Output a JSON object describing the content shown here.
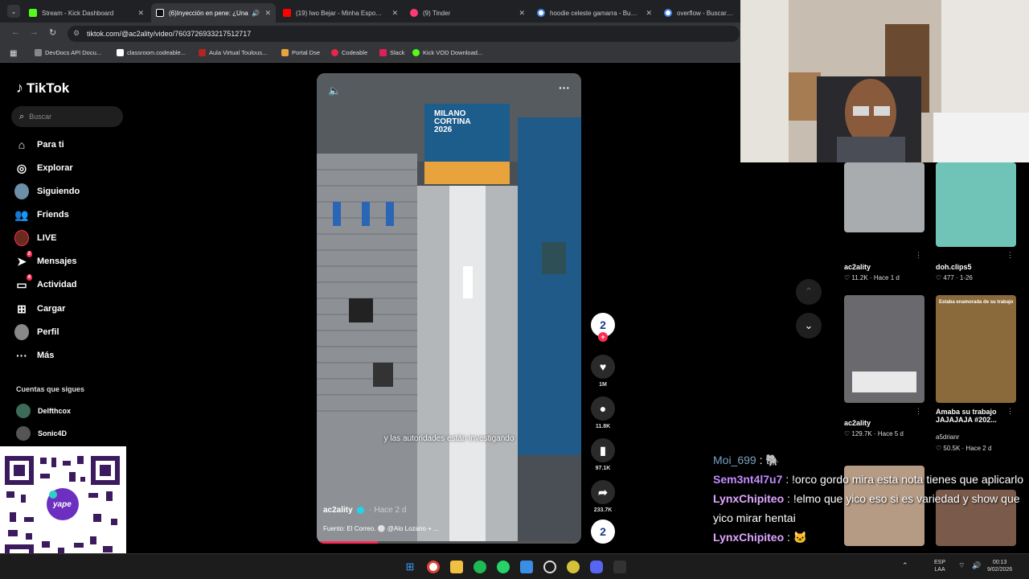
{
  "browser": {
    "tabs": [
      {
        "label": "Stream - Kick Dashboard",
        "color": "#53fc18"
      },
      {
        "label": "(6)Inyección en pene: ¿Una",
        "color": "#ffffff"
      },
      {
        "label": "(19) Iwo Bejar - Minha Esposa e",
        "color": "#ff0000"
      },
      {
        "label": "(9) Tinder",
        "color": "#fe3c72"
      },
      {
        "label": "hoodie celeste gamarra - Busca",
        "color": "#4285f4"
      },
      {
        "label": "overflow - Buscar con",
        "color": "#4285f4"
      }
    ],
    "url": "tiktok.com/@ac2ality/video/7603726933217512717",
    "bookmarks": [
      {
        "label": "DevDocs API Docu...",
        "color": "#888888"
      },
      {
        "label": "classroom.codeable...",
        "color": "#ffffff"
      },
      {
        "label": "Aula Virtual Toulous...",
        "color": "#b32424"
      },
      {
        "label": "Portal Dse",
        "color": "#e8a33d"
      },
      {
        "label": "Codeable",
        "color": "#e8254a"
      },
      {
        "label": "Slack",
        "color": "#e01e5a"
      },
      {
        "label": "Kick VOD Download...",
        "color": "#53fc18"
      }
    ]
  },
  "sidebar": {
    "brand": "TikTok",
    "search_placeholder": "Buscar",
    "items": [
      {
        "label": "Para ti",
        "icon": "home-icon"
      },
      {
        "label": "Explorar",
        "icon": "compass-icon"
      },
      {
        "label": "Siguiendo",
        "icon": "avatar"
      },
      {
        "label": "Friends",
        "icon": "friends-icon"
      },
      {
        "label": "LIVE",
        "icon": "live-icon"
      },
      {
        "label": "Mensajes",
        "icon": "paper-plane-icon",
        "badge": "2"
      },
      {
        "label": "Actividad",
        "icon": "inbox-icon",
        "badge": "4"
      },
      {
        "label": "Cargar",
        "icon": "plus-square-icon"
      },
      {
        "label": "Perfil",
        "icon": "avatar"
      },
      {
        "label": "Más",
        "icon": "more-icon"
      }
    ],
    "following_title": "Cuentas que sigues",
    "following": [
      "Delfthcox",
      "Sonic4D"
    ]
  },
  "video": {
    "banner_line1": "MILANO",
    "banner_line2": "CORTINA",
    "banner_line3": "2026",
    "caption": "y las autoridades están investigando",
    "author": "ac2ality",
    "age": "· Hace 2 d",
    "description": "Fuento: El Correo. ⚪ @Alo Lozano + ..."
  },
  "actions": {
    "likes": "1M",
    "comments": "11.8K",
    "saves": "97.1K",
    "shares": "233.7K",
    "badge": "2"
  },
  "recommended": [
    {
      "author": "ac2ality",
      "stats": "♡ 11.2K · Hace 1 d"
    },
    {
      "author": "doh.clips5",
      "stats": "♡ 477 · 1-26"
    },
    {
      "author": "ac2ality",
      "stats": "♡ 129.7K · Hace 5 d"
    },
    {
      "title": "Amaba su trabajo JAJAJAJA #202...",
      "author": "a5drianr",
      "stats": "♡ 50.5K · Hace 2 d",
      "overlay": "Estaba enamorada de su trabajo"
    }
  ],
  "chat": [
    {
      "user": "Moi_699",
      "color": "#7aa2c4",
      "msg": " : 🐘"
    },
    {
      "user": "Sem3nt4l7u7",
      "color": "#c38cff",
      "msg": " : !orco gordo mira esta nota tienes que aplicarlo"
    },
    {
      "user": "LynxChipiteo",
      "color": "#e0a7ff",
      "msg": " : !elmo que yico eso si es variedad y show que yico mirar hentai"
    },
    {
      "user": "LynxChipiteo",
      "color": "#e0a7ff",
      "msg": " : 🐱"
    }
  ],
  "qr": {
    "brand": "yape"
  },
  "taskbar": {
    "lang1": "ESP",
    "lang2": "LAA",
    "time": "00:13",
    "date": "9/02/2026"
  }
}
